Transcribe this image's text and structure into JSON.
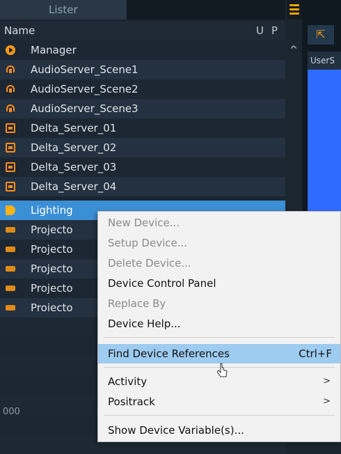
{
  "lister": {
    "tab_label": "Lister",
    "header": {
      "name": "Name",
      "u": "U",
      "p": "P"
    },
    "items": [
      {
        "label": "Manager",
        "icon": "play-icon"
      },
      {
        "label": "AudioServer_Scene1",
        "icon": "audio-server-icon"
      },
      {
        "label": "AudioServer_Scene2",
        "icon": "audio-server-icon"
      },
      {
        "label": "AudioServer_Scene3",
        "icon": "audio-server-icon"
      },
      {
        "label": "Delta_Server_01",
        "icon": "server-icon"
      },
      {
        "label": "Delta_Server_02",
        "icon": "server-icon"
      },
      {
        "label": "Delta_Server_03",
        "icon": "server-icon"
      },
      {
        "label": "Delta_Server_04",
        "icon": "server-icon"
      },
      {
        "label": "Lighting",
        "icon": "lighting-icon",
        "selected": true
      },
      {
        "label": "Projecto",
        "icon": "projector-icon"
      },
      {
        "label": "Projecto",
        "icon": "projector-icon"
      },
      {
        "label": "Projecto",
        "icon": "projector-icon"
      },
      {
        "label": "Projecto",
        "icon": "projector-icon"
      },
      {
        "label": "Proiecto",
        "icon": "projector-icon"
      }
    ],
    "footer_text": "000"
  },
  "right_panel": {
    "user_label": "UserS"
  },
  "context_menu": {
    "items": [
      {
        "label": "New Device...",
        "disabled": true
      },
      {
        "label": "Setup Device...",
        "disabled": true
      },
      {
        "label": "Delete Device...",
        "disabled": true
      },
      {
        "label": "Device Control Panel",
        "disabled": false
      },
      {
        "label": "Replace By",
        "disabled": true
      },
      {
        "label": "Device Help...",
        "disabled": false
      },
      {
        "label": "Find Device References",
        "shortcut": "Ctrl+F",
        "highlighted": true
      },
      {
        "label": "Activity",
        "submenu": true
      },
      {
        "label": "Positrack",
        "submenu": true
      },
      {
        "label": "Show Device Variable(s)..."
      }
    ]
  },
  "colors": {
    "accent_orange": "#ff8c1a",
    "selection_blue": "#3b8fd4",
    "menu_highlight": "#9ecbf0",
    "right_blue": "#2f6bff"
  }
}
